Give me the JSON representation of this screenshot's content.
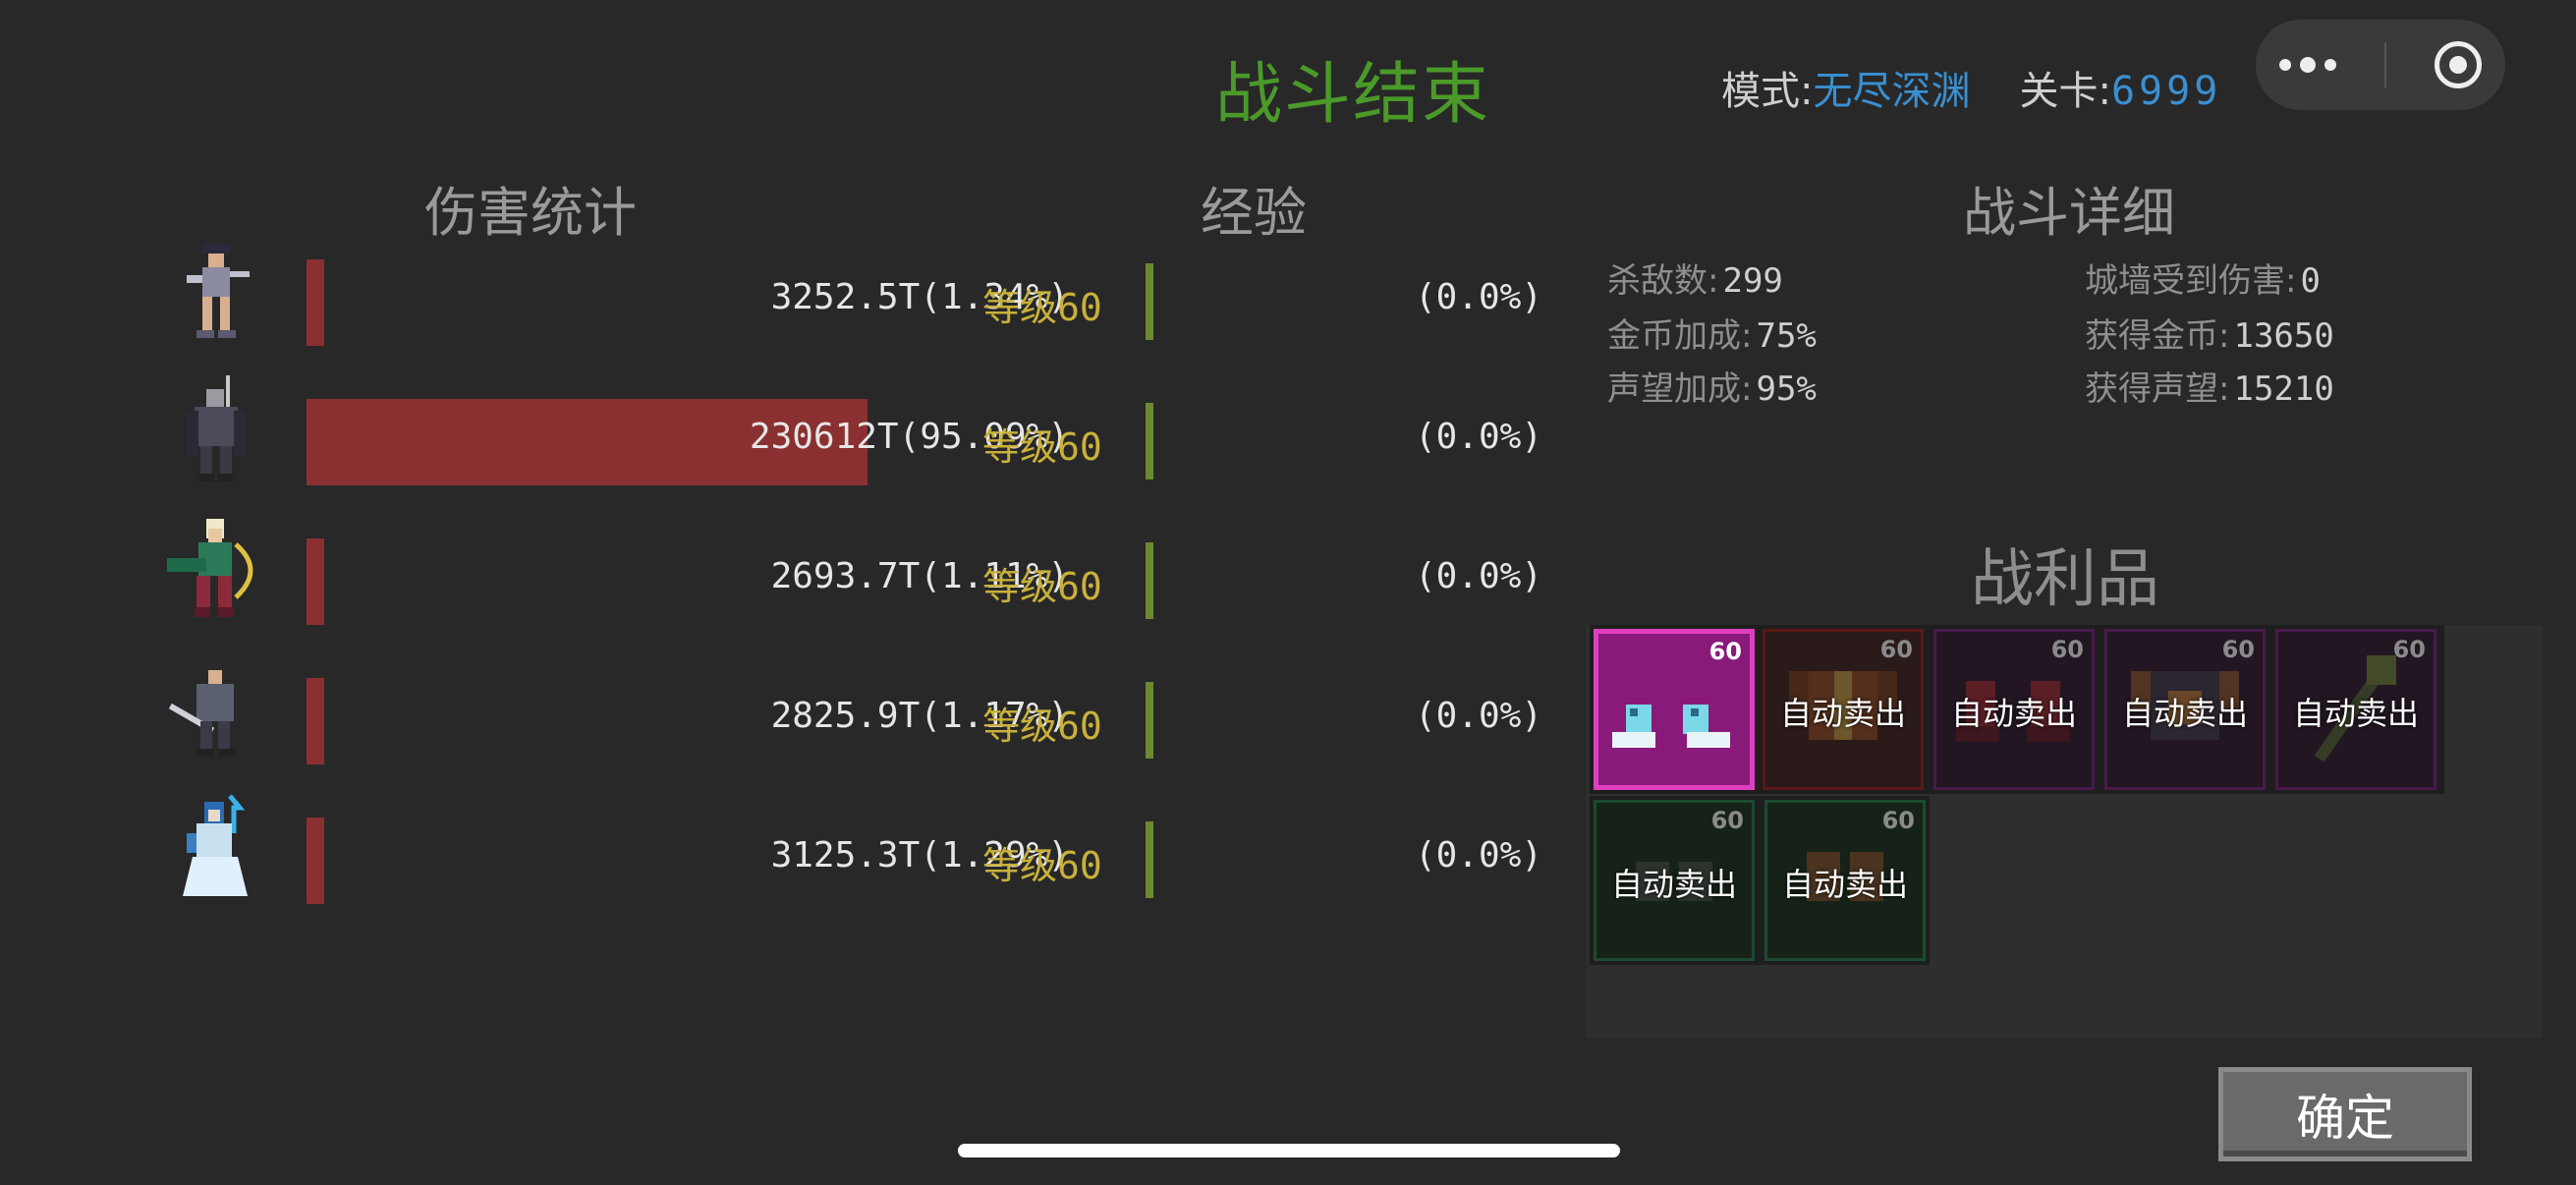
{
  "title": "战斗结束",
  "header": {
    "mode_label": "模式:",
    "mode_value": "无尽深渊",
    "stage_label": "关卡:",
    "stage_value": "6999"
  },
  "sections": {
    "damage": "伤害统计",
    "exp": "经验",
    "detail": "战斗详细",
    "loot": "战利品"
  },
  "heroes": [
    {
      "damage": "3252.5T(1.34%)",
      "damage_pct": 1.34,
      "level_label": "等级",
      "level": "60",
      "exp": "(0.0%)"
    },
    {
      "damage": "230612T(95.09%)",
      "damage_pct": 95.09,
      "level_label": "等级",
      "level": "60",
      "exp": "(0.0%)"
    },
    {
      "damage": "2693.7T(1.11%)",
      "damage_pct": 1.11,
      "level_label": "等级",
      "level": "60",
      "exp": "(0.0%)"
    },
    {
      "damage": "2825.9T(1.17%)",
      "damage_pct": 1.17,
      "level_label": "等级",
      "level": "60",
      "exp": "(0.0%)"
    },
    {
      "damage": "3125.3T(1.29%)",
      "damage_pct": 1.29,
      "level_label": "等级",
      "level": "60",
      "exp": "(0.0%)"
    }
  ],
  "stats": {
    "kills_label": "杀敌数:",
    "kills": "299",
    "wall_label": "城墙受到伤害:",
    "wall": "0",
    "gold_bonus_label": "金币加成:",
    "gold_bonus": "75%",
    "gold_label": "获得金币:",
    "gold": "13650",
    "fame_bonus_label": "声望加成:",
    "fame_bonus": "95%",
    "fame_label": "获得声望:",
    "fame": "15210"
  },
  "loot": [
    {
      "level": "60",
      "sell": "",
      "icon": "boots-icon",
      "rarity_color": "#d63bb8"
    },
    {
      "level": "60",
      "sell": "自动卖出",
      "icon": "armor-icon",
      "rarity_color": "#7a2020"
    },
    {
      "level": "60",
      "sell": "自动卖出",
      "icon": "boots-icon",
      "rarity_color": "#5a1d5a"
    },
    {
      "level": "60",
      "sell": "自动卖出",
      "icon": "armor-icon",
      "rarity_color": "#5a1d5a"
    },
    {
      "level": "60",
      "sell": "自动卖出",
      "icon": "staff-icon",
      "rarity_color": "#5a1d5a"
    },
    {
      "level": "60",
      "sell": "自动卖出",
      "icon": "gloves-icon",
      "rarity_color": "#1c4a30"
    },
    {
      "level": "60",
      "sell": "自动卖出",
      "icon": "gloves-icon",
      "rarity_color": "#1c4a30"
    }
  ],
  "confirm_label": "确定",
  "colors": {
    "damage_bar": "#8a3030",
    "exp_bar": "#6a8a30",
    "level_text": "#c9b13a",
    "title": "#4a9a2a",
    "mode_value": "#3a8fd0"
  }
}
